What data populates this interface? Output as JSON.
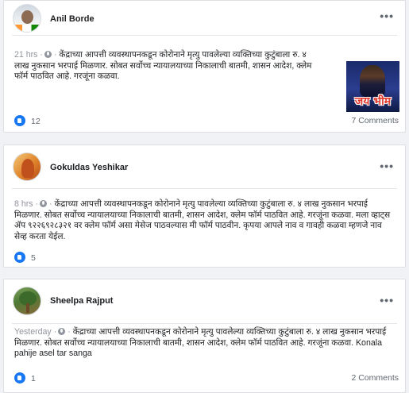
{
  "posts": [
    {
      "author": "Anil Borde",
      "avatar_icon": "profile-photo-flag",
      "time": "21 hrs",
      "text": "केंद्राच्या आपत्ती व्यवस्थापनकडून कोरोनाने मृत्यु पावलेल्या व्यक्तिच्या कुटुंबाला रु. ४ लाख नुकसान भरपाई मिळणार. सोबत सर्वोच्च न्यायालयाच्या निकालाची बातमी, शासन आदेश, क्लेम फॉर्म पाठवित आहे. गरजूंना कळवा.",
      "image_caption": "जय भीम",
      "likes": "12",
      "comments": "7 Comments"
    },
    {
      "author": "Gokuldas Yeshikar",
      "avatar_icon": "profile-photo-portrait",
      "time": "8 hrs",
      "text": "केंद्राच्या आपत्ती व्यवस्थापनकडून कोरोनाने मृत्यु पावलेल्या व्यक्तिच्या कुटुंबाला रु. ४ लाख नुकसान भरपाई मिळणार. सोबत सर्वोच्च न्यायालयाच्या निकालाची बातमी, शासन आदेश, क्लेम फॉर्म पाठवित आहे. गरजूंना कळवा. मला व्हाट्स ॲप ९२२६९२८३२१ वर क्लेम फॉर्म असा मेसेज पाठवल्यास मी फॉर्म पाठवीन. कृपया आपले नाव व गावही कळवा म्हणजे नाव सेव्ह करता येईल.",
      "likes": "5",
      "comments": ""
    },
    {
      "author": "Sheelpa Rajput",
      "avatar_icon": "profile-photo-tree",
      "time": "Yesterday",
      "text": "केंद्राच्या आपत्ती व्यवस्थापनकडून कोरोनाने मृत्यु पावलेल्या व्यक्तिच्या कुटुंबाला रु. ४ लाख नुकसान भरपाई मिळणार. सोबत सर्वोच्च न्यायालयाच्या निकालाची बातमी, शासन आदेश, क्लेम फॉर्म पाठवित आहे. गरजूंना कळवा. Konala pahije asel tar sanga",
      "likes": "1",
      "comments": "2 Comments"
    }
  ],
  "ui": {
    "more_label": "•••",
    "separator": "·"
  },
  "colors": {
    "like": "#1877f2",
    "muted": "#90949c",
    "background": "#f0f2f5"
  }
}
